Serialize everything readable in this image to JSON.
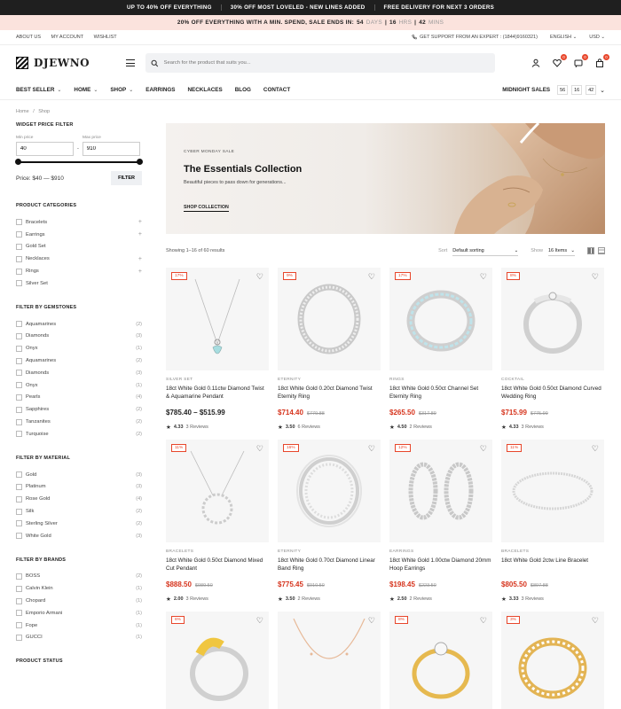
{
  "topbar": {
    "msgs": [
      "UP TO 40% OFF EVERYTHING",
      "30% OFF MOST LOVELED - NEW LINES ADDED",
      "FREE DELIVERY FOR NEXT 3 ORDERS"
    ]
  },
  "salebar": {
    "text": "20% OFF EVERYTHING WITH A MIN. SPEND, SALE ENDS IN:",
    "days": "54",
    "days_label": "DAYS",
    "hrs": "16",
    "hrs_label": "HRS",
    "mins": "42",
    "mins_label": "MINS"
  },
  "util": {
    "about": "ABOUT US",
    "account": "MY ACCOUNT",
    "wishlist": "WISHLIST",
    "support": "GET SUPPORT FROM AN EXPERT : (1844)9160321)",
    "language": "ENGLISH",
    "currency": "USD"
  },
  "header": {
    "logo": "DJEWNO",
    "search_placeholder": "Search for the product that suits you...",
    "wishlist_count": "0",
    "compare_count": "0",
    "cart_count": "0"
  },
  "nav": {
    "items": [
      "BEST SELLER",
      "HOME",
      "SHOP",
      "EARRINGS",
      "NECKLACES",
      "BLOG",
      "CONTACT"
    ],
    "midnight": "MIDNIGHT SALES",
    "timer": [
      "56",
      "16",
      "42"
    ]
  },
  "breadcrumb": {
    "home": "Home",
    "sep": "/",
    "current": "Shop"
  },
  "price_filter": {
    "title": "WIDGET PRICE FILTER",
    "min_label": "Min price",
    "max_label": "Max price",
    "min": "40",
    "max": "910",
    "dash": "-",
    "range_text": "Price: $40 — $910",
    "button": "FILTER"
  },
  "categories": {
    "title": "PRODUCT CATEGORIES",
    "items": [
      "Bracelets",
      "Earrings",
      "Gold Set",
      "Necklaces",
      "Rings",
      "Silver Set"
    ],
    "plus": "+"
  },
  "gemstones": {
    "title": "FILTER BY GEMSTONES",
    "items": [
      {
        "name": "Aquamarines",
        "count": "(2)"
      },
      {
        "name": "Diamonds",
        "count": "(3)"
      },
      {
        "name": "Onyx",
        "count": "(1)"
      },
      {
        "name": "Aquamarines",
        "count": "(2)"
      },
      {
        "name": "Diamonds",
        "count": "(3)"
      },
      {
        "name": "Onyx",
        "count": "(1)"
      },
      {
        "name": "Pearls",
        "count": "(4)"
      },
      {
        "name": "Sapphires",
        "count": "(2)"
      },
      {
        "name": "Tanzanites",
        "count": "(2)"
      },
      {
        "name": "Turquoise",
        "count": "(2)"
      }
    ]
  },
  "material": {
    "title": "FILTER BY MATERIAL",
    "items": [
      {
        "name": "Gold",
        "count": "(3)"
      },
      {
        "name": "Platinum",
        "count": "(3)"
      },
      {
        "name": "Rose Gold",
        "count": "(4)"
      },
      {
        "name": "Silk",
        "count": "(2)"
      },
      {
        "name": "Sterling Silver",
        "count": "(2)"
      },
      {
        "name": "White Gold",
        "count": "(3)"
      }
    ]
  },
  "brands": {
    "title": "FILTER BY BRANDS",
    "items": [
      {
        "name": "BOSS",
        "count": "(2)"
      },
      {
        "name": "Calvin Klein",
        "count": "(1)"
      },
      {
        "name": "Chopard",
        "count": "(1)"
      },
      {
        "name": "Emporio Armani",
        "count": "(1)"
      },
      {
        "name": "Fope",
        "count": "(1)"
      },
      {
        "name": "GUCCI",
        "count": "(1)"
      }
    ]
  },
  "status": {
    "title": "PRODUCT STATUS"
  },
  "banner": {
    "kicker": "CYBER MONDAY SALE",
    "title": "The Essentials Collection",
    "subtitle": "Beautiful pieces to pass down for generations...",
    "link": "SHOP COLLECTION"
  },
  "toolbar": {
    "showing": "Showing 1–16 of 60 results",
    "sort_label": "Sort",
    "sort_value": "Default sorting",
    "show_label": "Show",
    "show_value": "16 Items"
  },
  "products": [
    {
      "disc": "17%",
      "cat": "SILVER SET",
      "name": "18ct White Gold 0.11ctw Diamond Twist & Aquamarine Pendant",
      "price": "$785.40 – $515.99",
      "old": "",
      "rating": "4.33",
      "reviews": "3 Reviews",
      "art": "pendant-aqua"
    },
    {
      "disc": "9%",
      "cat": "ETERNITY",
      "name": "18ct White Gold 0.20ct Diamond Twist Eternity Ring",
      "price": "$714.40",
      "old": "$779.88",
      "rating": "3.50",
      "reviews": "6 Reviews",
      "art": "ring-twist"
    },
    {
      "disc": "17%",
      "cat": "RINGS",
      "name": "18ct White Gold 0.50ct Channel Set Eternity Ring",
      "price": "$265.50",
      "old": "$317.89",
      "rating": "4.50",
      "reviews": "2 Reviews",
      "art": "ring-channel"
    },
    {
      "disc": "8%",
      "cat": "COCKTAIL",
      "name": "18ct White Gold 0.50ct Diamond Curved Wedding Ring",
      "price": "$715.99",
      "old": "$775.99",
      "rating": "4.33",
      "reviews": "3 Reviews",
      "art": "ring-curved"
    },
    {
      "disc": "11%",
      "cat": "BRACELETS",
      "name": "18ct White Gold 0.50ct Diamond Mixed Cut Pendant",
      "price": "$888.50",
      "old": "$989.50",
      "rating": "2.00",
      "reviews": "3 Reviews",
      "art": "pendant-circle"
    },
    {
      "disc": "16%",
      "cat": "ETERNITY",
      "name": "18ct White Gold 0.70ct Diamond Linear Band Ring",
      "price": "$775.45",
      "old": "$910.50",
      "rating": "3.50",
      "reviews": "2 Reviews",
      "art": "ring-multi"
    },
    {
      "disc": "12%",
      "cat": "EARRINGS",
      "name": "18ct White Gold 1.00ctw Diamond 20mm Hoop Earrings",
      "price": "$198.45",
      "old": "$223.50",
      "rating": "2.50",
      "reviews": "2 Reviews",
      "art": "hoops"
    },
    {
      "disc": "11%",
      "cat": "BRACELETS",
      "name": "18ct White Gold 2ctw Line Bracelet",
      "price": "$805.50",
      "old": "$897.88",
      "rating": "3.33",
      "reviews": "3 Reviews",
      "art": "bracelet"
    },
    {
      "disc": "6%",
      "cat": "",
      "name": "",
      "price": "",
      "old": "",
      "rating": "",
      "reviews": "",
      "art": "ring-yellow"
    },
    {
      "disc": "",
      "cat": "",
      "name": "",
      "price": "",
      "old": "",
      "rating": "",
      "reviews": "",
      "art": "necklace-rose"
    },
    {
      "disc": "8%",
      "cat": "",
      "name": "",
      "price": "",
      "old": "",
      "rating": "",
      "reviews": "",
      "art": "ring-gold-solitaire"
    },
    {
      "disc": "3%",
      "cat": "",
      "name": "",
      "price": "",
      "old": "",
      "rating": "",
      "reviews": "",
      "art": "ring-gold-band"
    }
  ]
}
